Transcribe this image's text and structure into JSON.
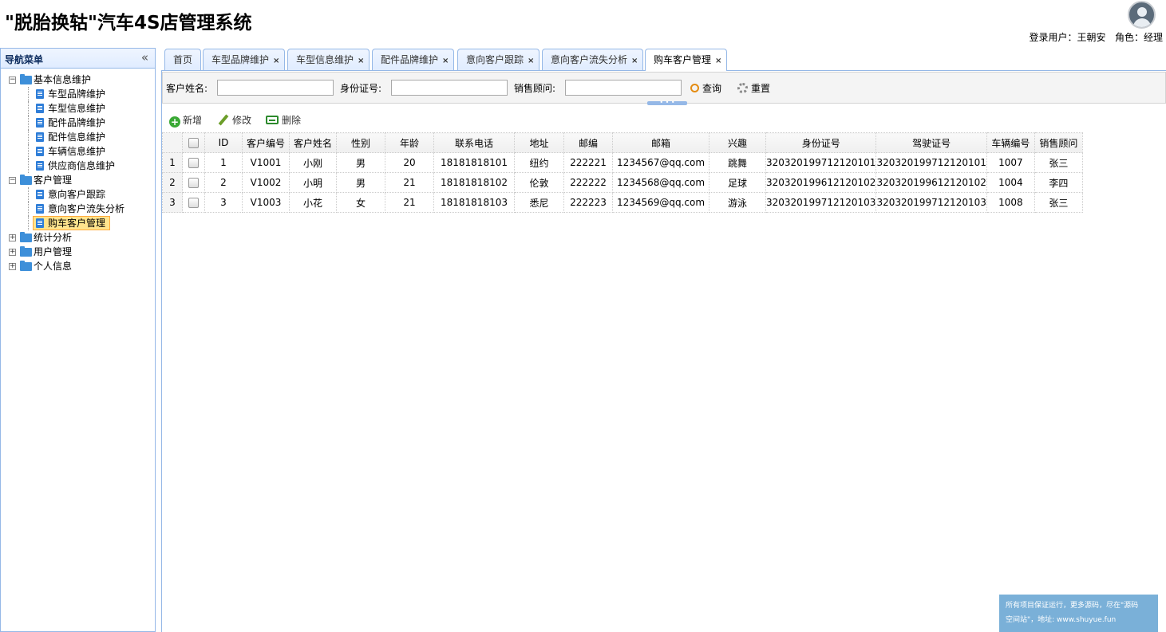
{
  "header": {
    "title": "\"脱胎换轱\"汽车4S店管理系统",
    "user_label": "登录用户：王朝安",
    "role_label": "角色：经理"
  },
  "nav": {
    "title": "导航菜单",
    "groups": [
      {
        "label": "基本信息维护",
        "expanded": true,
        "items": [
          "车型品牌维护",
          "车型信息维护",
          "配件品牌维护",
          "配件信息维护",
          "车辆信息维护",
          "供应商信息维护"
        ]
      },
      {
        "label": "客户管理",
        "expanded": true,
        "items": [
          "意向客户跟踪",
          "意向客户流失分析",
          "购车客户管理"
        ]
      },
      {
        "label": "统计分析",
        "expanded": false,
        "items": []
      },
      {
        "label": "用户管理",
        "expanded": false,
        "items": []
      },
      {
        "label": "个人信息",
        "expanded": false,
        "items": []
      }
    ],
    "selected_item": "购车客户管理"
  },
  "tabs": [
    {
      "label": "首页",
      "closable": false,
      "active": false
    },
    {
      "label": "车型品牌维护",
      "closable": true,
      "active": false
    },
    {
      "label": "车型信息维护",
      "closable": true,
      "active": false
    },
    {
      "label": "配件品牌维护",
      "closable": true,
      "active": false
    },
    {
      "label": "意向客户跟踪",
      "closable": true,
      "active": false
    },
    {
      "label": "意向客户流失分析",
      "closable": true,
      "active": false
    },
    {
      "label": "购车客户管理",
      "closable": true,
      "active": true
    }
  ],
  "search": {
    "name_label": "客户姓名:",
    "name_value": "",
    "id_label": "身份证号:",
    "id_value": "",
    "consultant_label": "销售顾问:",
    "consultant_value": "",
    "query_label": "查询",
    "reset_label": "重置"
  },
  "toolbar": {
    "add_label": "新增",
    "edit_label": "修改",
    "delete_label": "删除"
  },
  "grid": {
    "columns": [
      "ID",
      "客户编号",
      "客户姓名",
      "性别",
      "年龄",
      "联系电话",
      "地址",
      "邮编",
      "邮箱",
      "兴趣",
      "身份证号",
      "驾驶证号",
      "车辆编号",
      "销售顾问"
    ],
    "rows": [
      [
        "1",
        "1",
        "V1001",
        "小刚",
        "男",
        "20",
        "18181818101",
        "纽约",
        "222221",
        "1234567@qq.com",
        "跳舞",
        "320320199712120101",
        "320320199712120101",
        "1007",
        "张三"
      ],
      [
        "2",
        "2",
        "V1002",
        "小明",
        "男",
        "21",
        "18181818102",
        "伦敦",
        "222222",
        "1234568@qq.com",
        "足球",
        "320320199612120102",
        "320320199612120102",
        "1004",
        "李四"
      ],
      [
        "3",
        "3",
        "V1003",
        "小花",
        "女",
        "21",
        "18181818103",
        "悉尼",
        "222223",
        "1234569@qq.com",
        "游泳",
        "320320199712120103",
        "320320199712120103",
        "1008",
        "张三"
      ]
    ]
  },
  "watermark": {
    "line1": "所有项目保证运行，更多源码，尽在\"源码",
    "line2": "空间站\"，地址: www.shuyue.fun"
  }
}
